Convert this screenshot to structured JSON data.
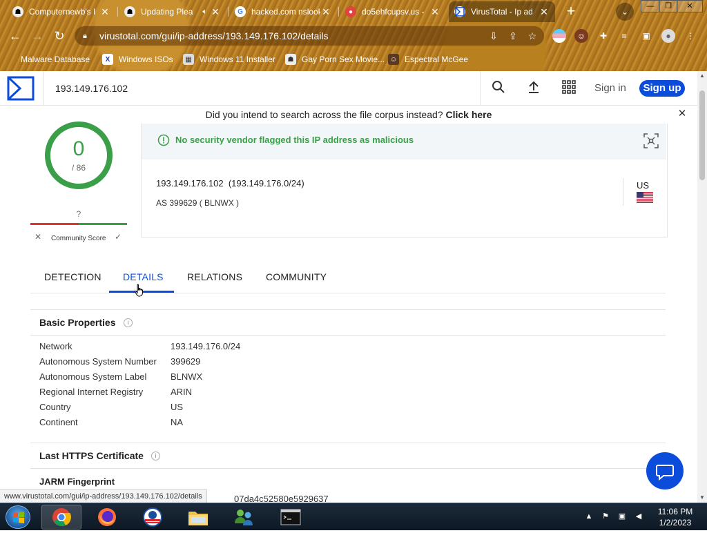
{
  "browser": {
    "tabs": [
      {
        "title": "Computernewb's I",
        "favicon": "bot-favicon"
      },
      {
        "title": "Updating Plea",
        "favicon": "bot-favicon"
      },
      {
        "title": "hacked.com nslook",
        "favicon": "google-favicon"
      },
      {
        "title": "do5ehfcupsv.us - ",
        "favicon": "pin-favicon"
      },
      {
        "title": "VirusTotal - Ip ad",
        "favicon": "virustotal-favicon"
      }
    ],
    "active_tab": 4,
    "url": "virustotal.com/gui/ip-address/193.149.176.102/details",
    "bookmarks": [
      {
        "label": "Malware Database"
      },
      {
        "label": "Windows ISOs"
      },
      {
        "label": "Windows 11 Installer"
      },
      {
        "label": "Gay Porn Sex Movie..."
      },
      {
        "label": "Espectral McGee"
      }
    ]
  },
  "vt": {
    "search_value": "193.149.176.102",
    "signin_label": "Sign in",
    "signup_label": "Sign up",
    "banner_text": "Did you intend to search across the file corpus instead?",
    "banner_link": "Click here",
    "score": "0",
    "score_total": "/ 86",
    "community_score_value": "?",
    "community_score_label": "Community Score",
    "verdict_text": "No security vendor flagged this IP address as malicious",
    "ip_line": "193.149.176.102  (193.149.176.0/24)",
    "as_line": "AS 399629 ( BLNWX )",
    "country_code": "US",
    "tabs": [
      "DETECTION",
      "DETAILS",
      "RELATIONS",
      "COMMUNITY"
    ],
    "active_tab": "DETAILS",
    "basic_properties_title": "Basic Properties",
    "properties": [
      {
        "label": "Network",
        "value": "193.149.176.0/24"
      },
      {
        "label": "Autonomous System Number",
        "value": "399629"
      },
      {
        "label": "Autonomous System Label",
        "value": "BLNWX"
      },
      {
        "label": "Regional Internet Registry",
        "value": "ARIN"
      },
      {
        "label": "Country",
        "value": "US"
      },
      {
        "label": "Continent",
        "value": "NA"
      }
    ],
    "https_cert_title": "Last HTTPS Certificate",
    "jarm_title": "JARM Fingerprint",
    "jarm_partial": "07da4c52580e5929637",
    "status_url": "www.virustotal.com/gui/ip-address/193.149.176.102/details"
  },
  "taskbar": {
    "time": "11:06 PM",
    "date": "1/2/2023"
  },
  "colors": {
    "vt_blue": "#0b4dda",
    "clean_green": "#3b9f4a"
  }
}
